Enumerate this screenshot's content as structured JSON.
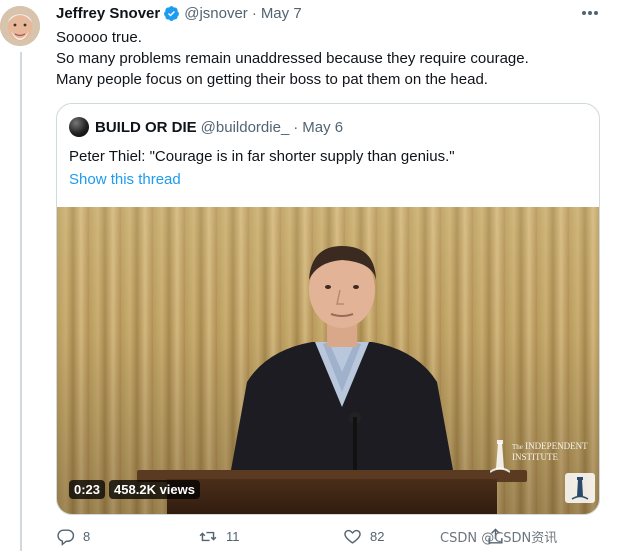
{
  "tweet": {
    "author_name": "Jeffrey Snover",
    "author_handle": "@jsnover",
    "separator": "·",
    "date": "May 7",
    "lines": [
      "Sooooo true.",
      "So many problems remain unaddressed because they require courage.",
      "Many people focus on getting their boss to pat them on the head."
    ],
    "more_icon": "more-horizontal-icon",
    "verified_icon": "verified-badge-icon"
  },
  "quote": {
    "author_name": "BUILD OR DIE",
    "author_handle": "@buildordie_",
    "separator": "·",
    "date": "May 6",
    "text": "Peter Thiel: \"Courage is in far shorter supply than genius.\"",
    "show_thread": "Show this thread",
    "video": {
      "elapsed": "0:23",
      "views": "458.2K views",
      "watermark_the": "The",
      "watermark_line1": "INDEPENDENT",
      "watermark_line2": "INSTITUTE"
    }
  },
  "actions": {
    "reply_count": "8",
    "retweet_count": "11",
    "like_count": "82",
    "reply_icon": "reply-icon",
    "retweet_icon": "retweet-icon",
    "like_icon": "heart-icon",
    "share_icon": "share-icon"
  },
  "watermark_overlay": "CSDN @CSDN资讯",
  "colors": {
    "link": "#1d9bf0",
    "secondary_text": "#536471",
    "border": "#cfd9de",
    "verified": "#1d9bf0"
  }
}
